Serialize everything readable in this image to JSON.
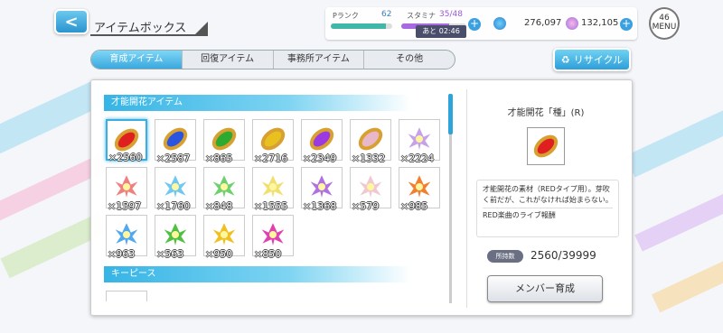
{
  "header": {
    "back_label": "<",
    "title": "アイテムボックス",
    "p_rank_label": "Pランク",
    "p_rank_value": "62",
    "stamina_label": "スタミナ",
    "stamina_value": "35/48",
    "stamina_fill": 0.73,
    "p_rank_fill": 0.9,
    "timer": "あと 02:46",
    "currency_1": "276,097",
    "currency_2": "132,105",
    "menu_badge": "46",
    "menu_label": "MENU"
  },
  "tabs": [
    {
      "label": "育成アイテム",
      "active": true
    },
    {
      "label": "回復アイテム",
      "active": false
    },
    {
      "label": "事務所アイテム",
      "active": false
    },
    {
      "label": "その他",
      "active": false
    }
  ],
  "recycle_label": "リサイクル",
  "sections": {
    "talent": "才能開花アイテム",
    "keypiece": "キーピース"
  },
  "items": [
    {
      "qty": "×2560",
      "shape": "seed",
      "color": "#e02020",
      "selected": true
    },
    {
      "qty": "×2587",
      "shape": "seed",
      "color": "#2a55e0"
    },
    {
      "qty": "×865",
      "shape": "seed",
      "color": "#2eaa30"
    },
    {
      "qty": "×2716",
      "shape": "seed",
      "color": "#e8c020"
    },
    {
      "qty": "×2349",
      "shape": "seed",
      "color": "#9a3ae0"
    },
    {
      "qty": "×1332",
      "shape": "seed",
      "color": "#e8b8c8"
    },
    {
      "qty": "×2224",
      "shape": "flower",
      "color": "#c8a0e8"
    },
    {
      "qty": "×1597",
      "shape": "flower",
      "color": "#f08080"
    },
    {
      "qty": "×1760",
      "shape": "flower",
      "color": "#70c8f0"
    },
    {
      "qty": "×848",
      "shape": "flower",
      "color": "#70d070"
    },
    {
      "qty": "×1555",
      "shape": "flower",
      "color": "#f0e070"
    },
    {
      "qty": "×1368",
      "shape": "flower",
      "color": "#b070e0"
    },
    {
      "qty": "×579",
      "shape": "flower",
      "color": "#f0c8d0"
    },
    {
      "qty": "×985",
      "shape": "flower",
      "color": "#f08030"
    },
    {
      "qty": "×963",
      "shape": "flower",
      "color": "#50a8f0"
    },
    {
      "qty": "×563",
      "shape": "flower",
      "color": "#50c040"
    },
    {
      "qty": "×950",
      "shape": "flower",
      "color": "#f0c020"
    },
    {
      "qty": "×850",
      "shape": "flower",
      "color": "#e040b0"
    }
  ],
  "detail": {
    "title": "才能開花「種」(R)",
    "desc_1": "才能開花の素材（REDタイプ用）。芽吹く前だが、これがなければ始まらない。",
    "desc_2": "RED楽曲のライブ報酬",
    "owned_label": "所持数",
    "owned_value": "2560/39999",
    "button_label": "メンバー育成"
  }
}
